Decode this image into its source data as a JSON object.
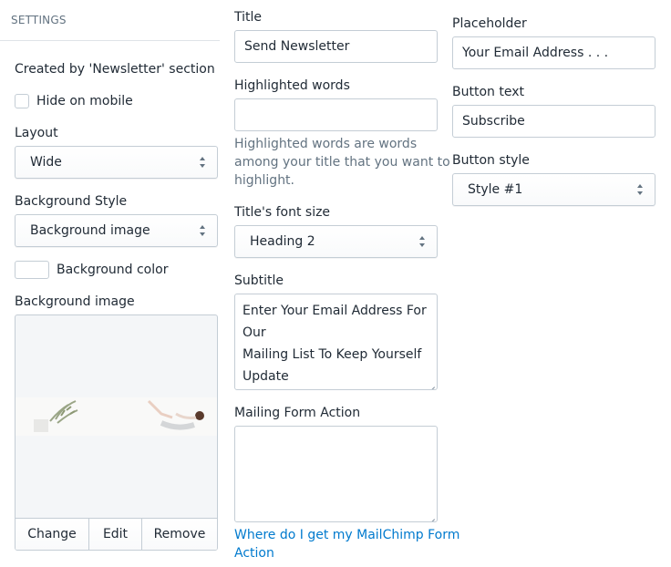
{
  "sidebar": {
    "header": "SETTINGS",
    "section_note": "Created by 'Newsletter' section",
    "hide_on_mobile": {
      "label": "Hide on mobile",
      "checked": false
    },
    "layout": {
      "label": "Layout",
      "value": "Wide"
    },
    "background_style": {
      "label": "Background Style",
      "value": "Background image"
    },
    "background_color": {
      "label": "Background color",
      "value": "#ffffff"
    },
    "background_image": {
      "label": "Background image",
      "actions": {
        "change": "Change",
        "edit": "Edit",
        "remove": "Remove"
      }
    }
  },
  "form": {
    "title": {
      "label": "Title",
      "value": "Send Newsletter"
    },
    "highlighted_words": {
      "label": "Highlighted words",
      "value": "",
      "help_lines": [
        "Highlighted words are words",
        "among your title that you want to",
        "highlight."
      ]
    },
    "title_font_size": {
      "label": "Title's font size",
      "value": "Heading 2"
    },
    "subtitle": {
      "label": "Subtitle",
      "lines": [
        "Enter Your Email Address For Our",
        "Mailing List To Keep Yourself",
        "Update"
      ]
    },
    "mailing_form_action": {
      "label": "Mailing Form Action",
      "value": "",
      "help_link_lines": [
        "Where do I get my MailChimp Form",
        "Action"
      ]
    },
    "placeholder": {
      "label": "Placeholder",
      "value": "Your Email Address . . ."
    },
    "button_text": {
      "label": "Button text",
      "value": "Subscribe"
    },
    "button_style": {
      "label": "Button style",
      "value": "Style #1"
    }
  },
  "colors": {
    "border": "#c4cdd5",
    "text": "#212b36",
    "muted": "#637381",
    "link": "#007ace"
  }
}
